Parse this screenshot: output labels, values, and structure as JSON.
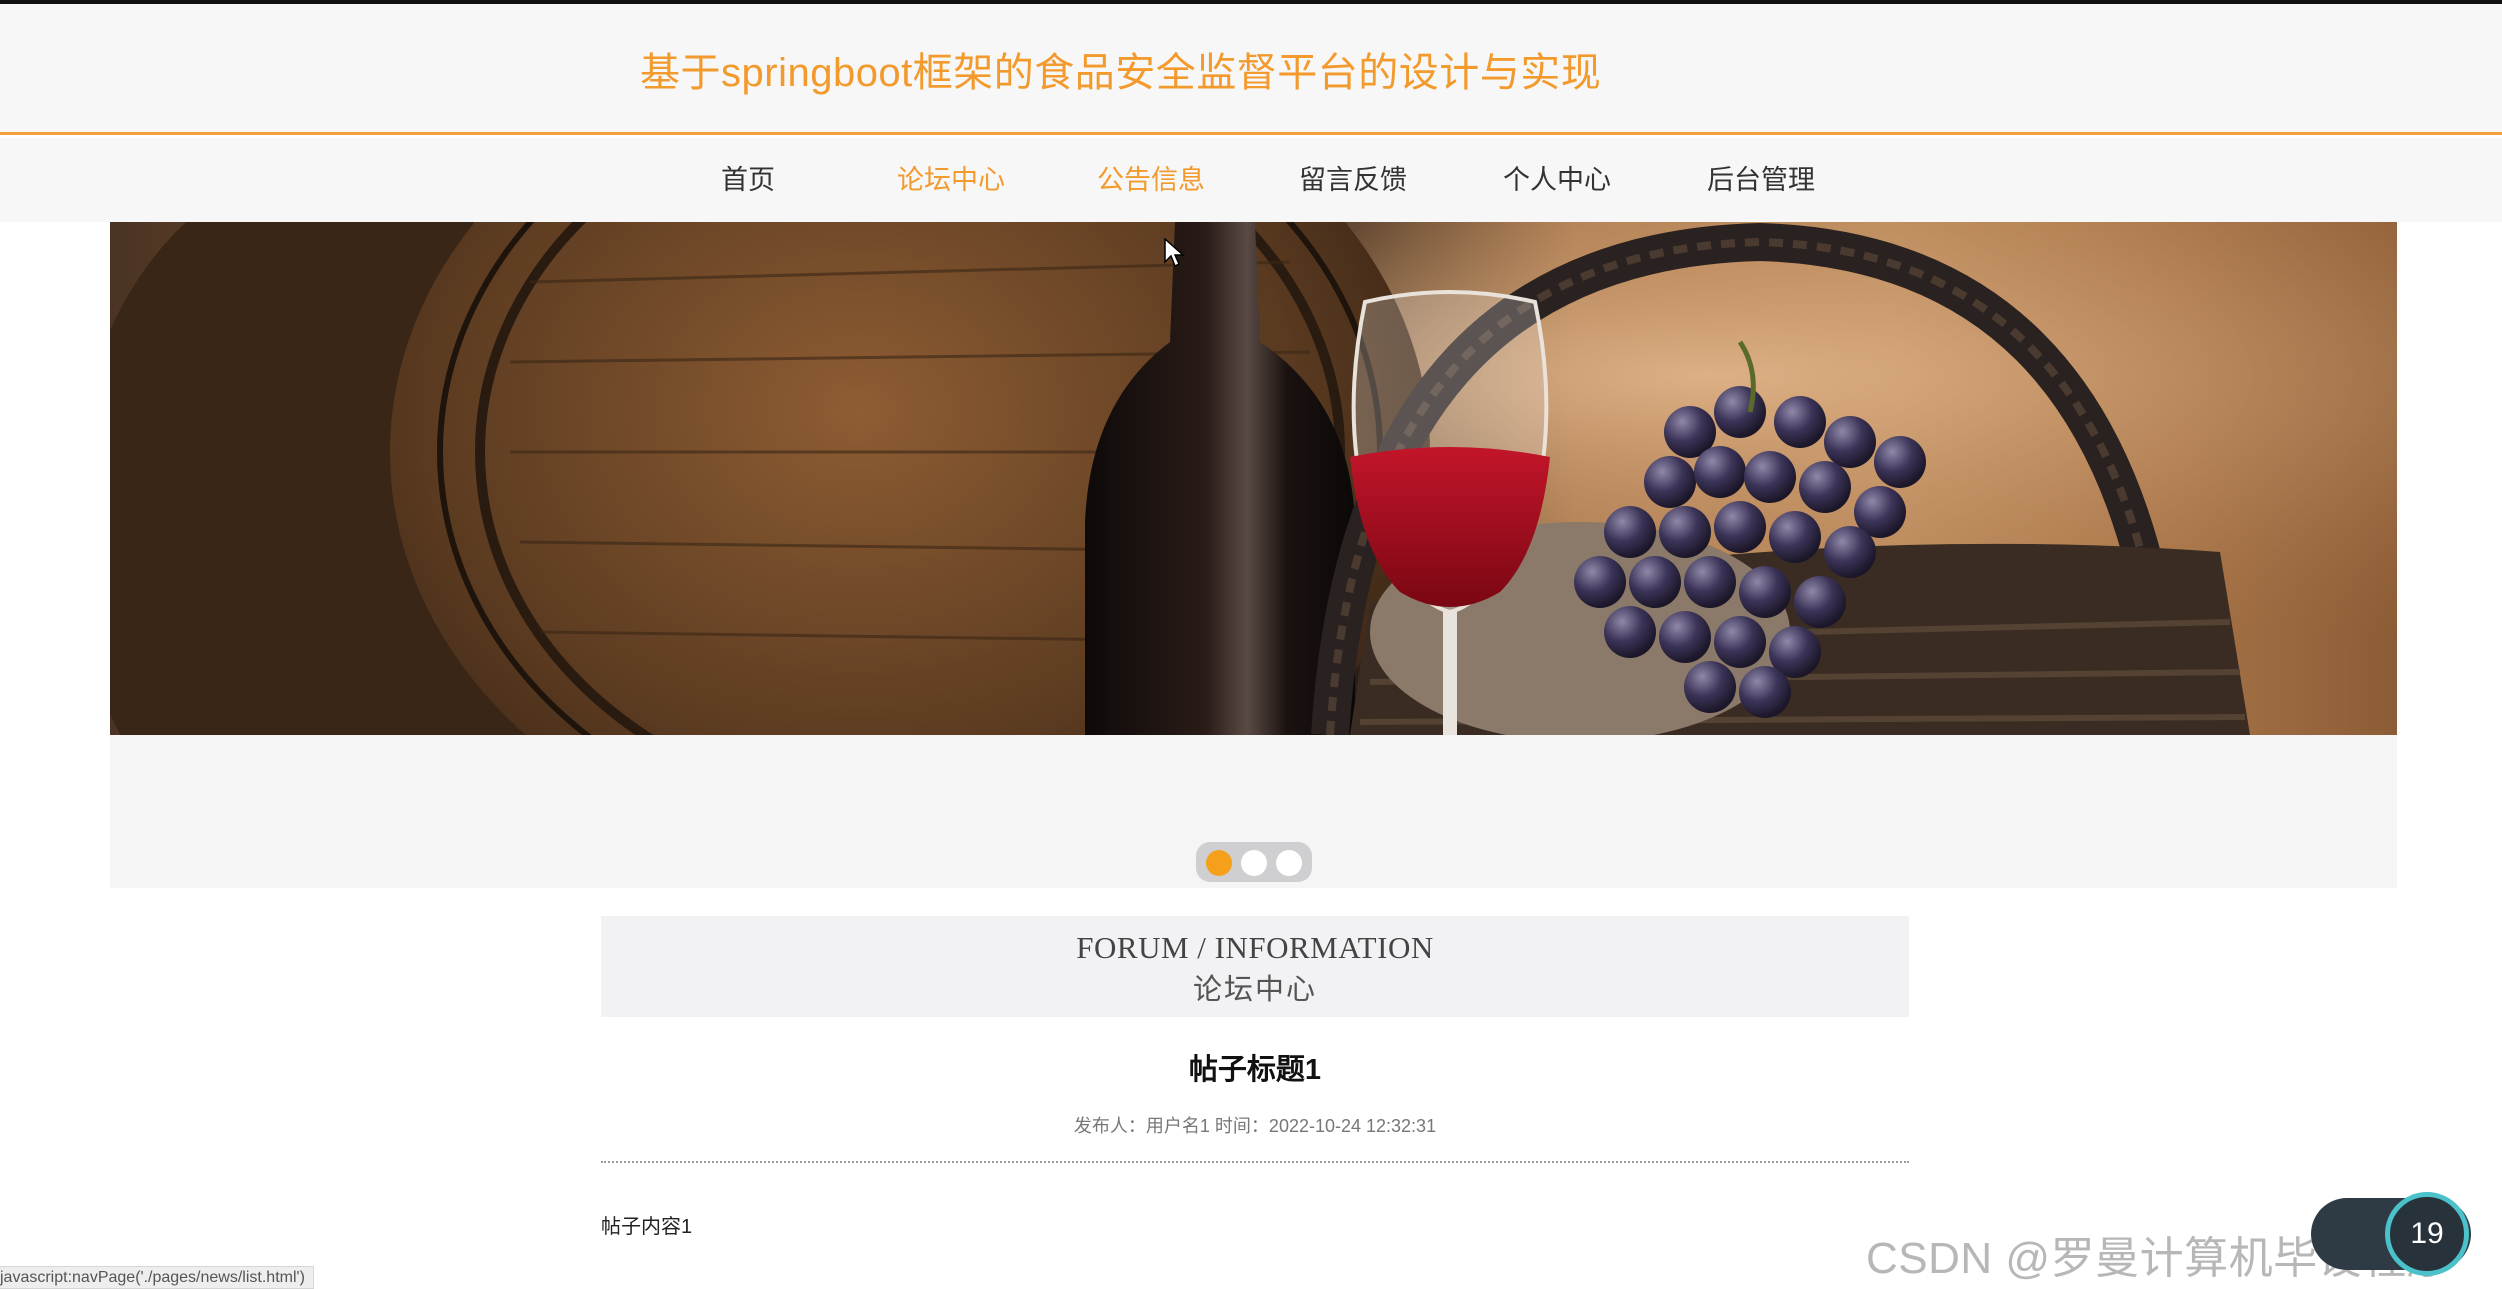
{
  "header": {
    "site_title": "基于springboot框架的食品安全监督平台的设计与实现"
  },
  "nav": {
    "items": [
      {
        "label": "首页",
        "active": false
      },
      {
        "label": "论坛中心",
        "active": true
      },
      {
        "label": "公告信息",
        "active": true
      },
      {
        "label": "留言反馈",
        "active": false
      },
      {
        "label": "个人中心",
        "active": false
      },
      {
        "label": "后台管理",
        "active": false
      }
    ]
  },
  "carousel": {
    "slide_count": 3,
    "active_index": 0
  },
  "section": {
    "title_en": "FORUM / INFORMATION",
    "title_cn": "论坛中心"
  },
  "post": {
    "title": "帖子标题1",
    "meta": "发布人：用户名1 时间：2022-10-24 12:32:31",
    "content": "帖子内容1"
  },
  "statusbar": {
    "text": "javascript:navPage('./pages/news/list.html')"
  },
  "watermark": {
    "text": "CSDN @罗曼计算机毕设程序"
  },
  "speed_widget": {
    "value": "19"
  },
  "colors": {
    "accent": "#f39a2d",
    "dot_active": "#f5a01a"
  }
}
